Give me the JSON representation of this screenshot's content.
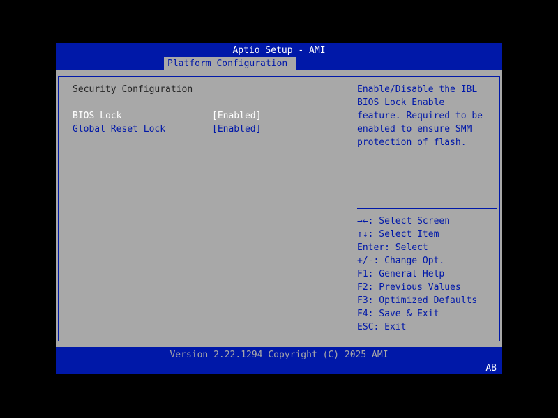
{
  "window": {
    "title": "Aptio Setup - AMI",
    "active_tab": "Platform Configuration"
  },
  "main": {
    "section_title": "Security Configuration",
    "options": [
      {
        "label": "BIOS Lock",
        "value": "[Enabled]"
      },
      {
        "label": "Global Reset Lock",
        "value": "[Enabled]"
      }
    ]
  },
  "help": {
    "description": "Enable/Disable the IBL\nBIOS Lock Enable\nfeature. Required to be\nenabled to ensure SMM\nprotection of flash.",
    "keys": [
      "→←: Select Screen",
      "↑↓: Select Item",
      "Enter: Select",
      "+/-: Change Opt.",
      "F1: General Help",
      "F2: Previous Values",
      "F3: Optimized Defaults",
      "F4: Save & Exit",
      "ESC: Exit"
    ]
  },
  "footer": {
    "version": "Version 2.22.1294 Copyright (C) 2025 AMI",
    "corner_code": "AB"
  },
  "colors": {
    "frame_blue": "#0018a8",
    "panel_gray": "#a8a8a8",
    "text_white": "#ffffff",
    "text_dark": "#262626"
  }
}
